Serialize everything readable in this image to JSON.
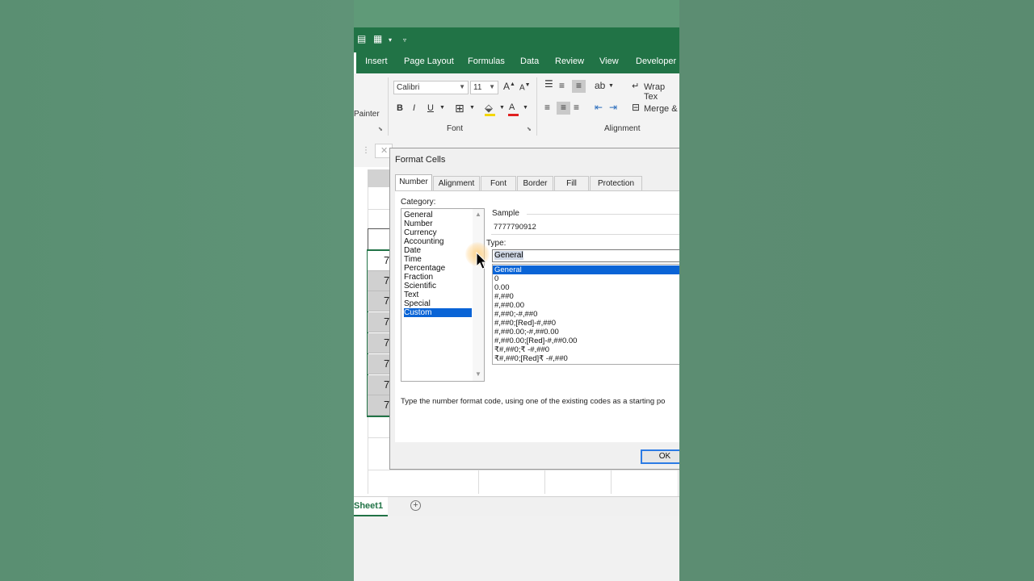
{
  "ribbon": {
    "tabs": [
      "Insert",
      "Page Layout",
      "Formulas",
      "Data",
      "Review",
      "View",
      "Developer"
    ],
    "font_name": "Calibri",
    "font_size": "11",
    "painter_label": "Painter",
    "font_group_label": "Font",
    "alignment_group_label": "Alignment",
    "wrap_text_label": "Wrap Tex",
    "merge_label": "Merge &",
    "bold": "B",
    "italic": "I",
    "underline": "U",
    "grow_font": "A",
    "shrink_font": "A",
    "font_color": "A"
  },
  "sheet": {
    "cell_values": [
      "7",
      "7",
      "7",
      "7",
      "7",
      "7",
      "7",
      "7"
    ],
    "sheet_tab": "Sheet1"
  },
  "dialog": {
    "title": "Format Cells",
    "tabs": [
      "Number",
      "Alignment",
      "Font",
      "Border",
      "Fill",
      "Protection"
    ],
    "category_label": "Category:",
    "categories": [
      "General",
      "Number",
      "Currency",
      "Accounting",
      "Date",
      "Time",
      "Percentage",
      "Fraction",
      "Scientific",
      "Text",
      "Special",
      "Custom"
    ],
    "selected_category": "Custom",
    "sample_label": "Sample",
    "sample_value": "7777790912",
    "type_label": "Type:",
    "type_value": "General",
    "type_list": [
      "General",
      "0",
      "0.00",
      "#,##0",
      "#,##0.00",
      "#,##0;-#,##0",
      "#,##0;[Red]-#,##0",
      "#,##0.00;-#,##0.00",
      "#,##0.00;[Red]-#,##0.00",
      "₹#,##0;₹ -#,##0",
      "₹#,##0;[Red]₹ -#,##0"
    ],
    "hint": "Type the number format code, using one of the existing codes as a starting po",
    "ok_label": "OK"
  },
  "colors": {
    "excel_green": "#217346",
    "selection_blue": "#0a64d6",
    "background_green": "#5f9377"
  }
}
